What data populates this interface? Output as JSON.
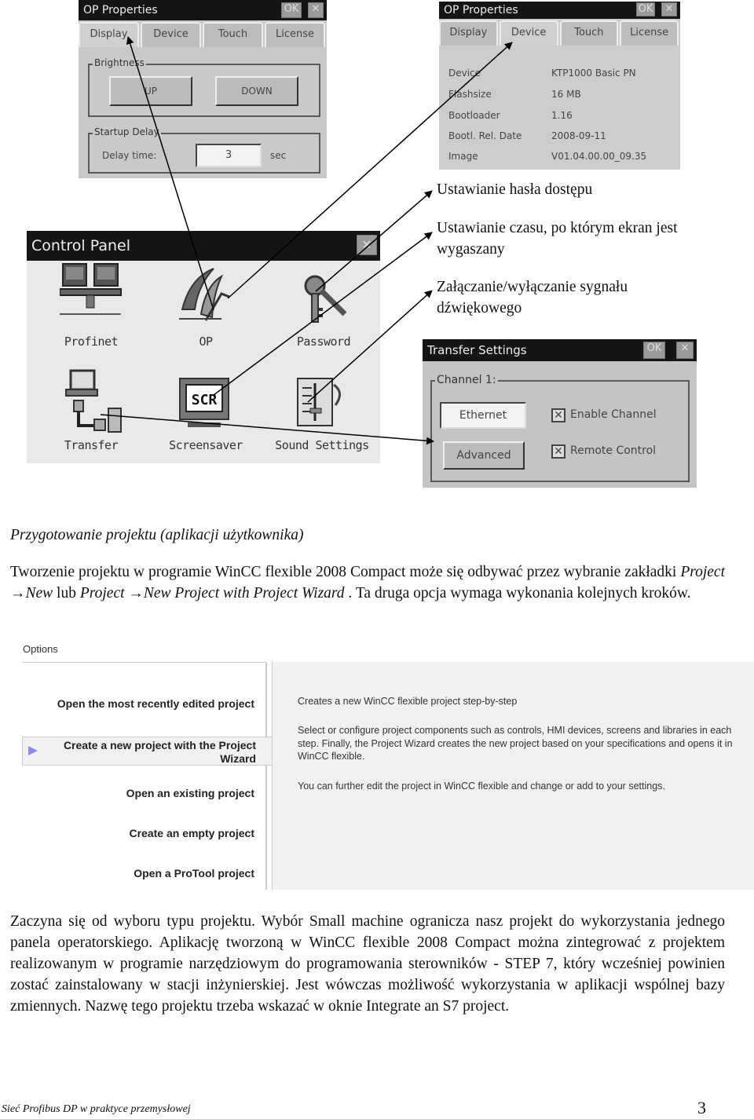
{
  "op_display": {
    "title": "OP Properties",
    "ok": "OK",
    "close": "✕",
    "tabs": [
      "Display",
      "Device",
      "Touch",
      "License"
    ],
    "active_tab": "Display",
    "brightness_label": "Brightness",
    "up_button": "UP",
    "down_button": "DOWN",
    "startup_delay_label": "Startup Delay",
    "delay_time_label": "Delay time:",
    "delay_time_value": "3",
    "delay_unit": "sec"
  },
  "op_device": {
    "title": "OP Properties",
    "ok": "OK",
    "close": "✕",
    "tabs": [
      "Display",
      "Device",
      "Touch",
      "License"
    ],
    "active_tab": "Device",
    "rows": [
      {
        "label": "Device",
        "value": "KTP1000 Basic PN"
      },
      {
        "label": "Flashsize",
        "value": "16 MB"
      },
      {
        "label": "Bootloader",
        "value": "1.16"
      },
      {
        "label": "Bootl. Rel. Date",
        "value": "2008-09-11"
      },
      {
        "label": "Image",
        "value": "V01.04.00.00_09.35"
      }
    ]
  },
  "callouts": [
    "Ustawianie hasła dostępu",
    "Ustawianie czasu, po którym ekran jest wygaszany",
    "Załączanie/wyłączanie sygnału dźwiękowego"
  ],
  "control_panel": {
    "title": "Control Panel",
    "close": "✕",
    "items": [
      {
        "label": "Profinet",
        "icon": "network-computers-icon"
      },
      {
        "label": "OP",
        "icon": "op-properties-icon"
      },
      {
        "label": "Password",
        "icon": "keys-icon"
      },
      {
        "label": "Transfer",
        "icon": "transfer-icon"
      },
      {
        "label": "Screensaver",
        "icon": "screensaver-monitor-icon",
        "icon_text": "SCR"
      },
      {
        "label": "Sound Settings",
        "icon": "sound-settings-icon"
      }
    ]
  },
  "transfer_settings": {
    "title": "Transfer Settings",
    "ok": "OK",
    "close": "✕",
    "channel_label": "Channel 1:",
    "channel_value": "Ethernet",
    "advanced_button": "Advanced",
    "enable_channel": {
      "label": "Enable Channel",
      "checked": true
    },
    "remote_control": {
      "label": "Remote Control",
      "checked": true
    }
  },
  "section_heading": "Przygotowanie projektu (aplikacji użytkownika)",
  "paragraph1": {
    "part1": "Tworzenie projektu w programie WinCC flexible 2008 Compact może się odbywać przez wybranie zakładki ",
    "menu1": "Project →New",
    "part2": " lub ",
    "menu2": "Project →New Project with Project Wizard",
    "part3": " . Ta druga opcja wymaga wykonania kolejnych kroków."
  },
  "options_dialog": {
    "title": "Options",
    "items": [
      "Open the most recently edited project",
      "Create a new project with the Project Wizard",
      "Open an existing project",
      "Create an empty project",
      "Open a ProTool project"
    ],
    "selected_index": 1,
    "description": [
      "Creates a new WinCC flexible project step-by-step",
      "Select or configure project components such as controls, HMI devices, screens and libraries in each step. Finally, the Project Wizard creates the new project based on your specifications and opens it in WinCC flexible.",
      "You can further edit the project in WinCC flexible and change or add to your settings."
    ]
  },
  "paragraph2": "Zaczyna się od wyboru typu projektu. Wybór Small machine ogranicza nasz projekt do wykorzystania jednego panela operatorskiego. Aplikację tworzoną w WinCC flexible 2008 Compact można zintegrować z projektem realizowanym w programie narzędziowym do programowania sterowników - STEP 7, który wcześniej powinien zostać zainstalowany w stacji inżynierskiej. Jest wówczas możliwość wykorzystania w aplikacji wspólnej bazy zmiennych. Nazwę tego projektu trzeba wskazać w oknie Integrate an S7 project.",
  "footer": {
    "title": "Sieć Profibus DP w praktyce przemysłowej",
    "page_number": "3"
  }
}
